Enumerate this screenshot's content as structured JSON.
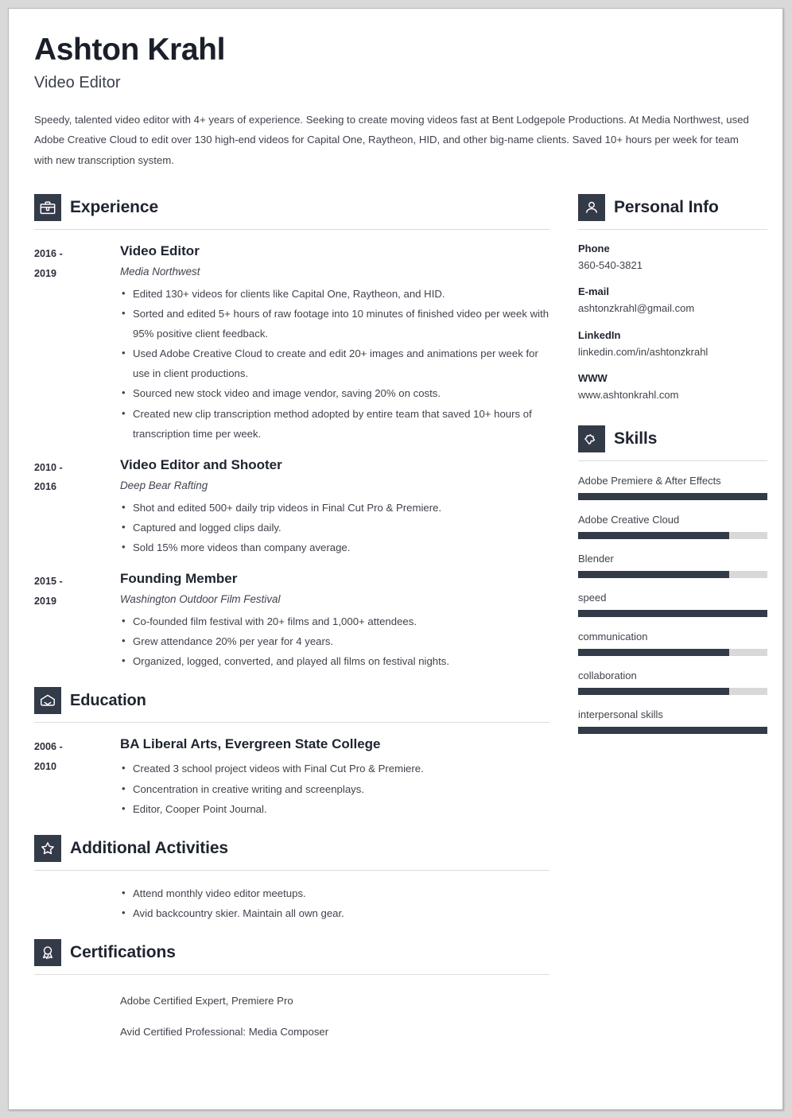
{
  "header": {
    "name": "Ashton Krahl",
    "job_title": "Video Editor",
    "summary": "Speedy, talented video editor with 4+ years of experience. Seeking to create moving videos fast at Bent Lodgepole Productions. At Media Northwest, used Adobe Creative Cloud to edit over 130 high-end videos for Capital One, Raytheon, HID, and other big-name clients. Saved 10+ hours per week for team with new transcription system."
  },
  "colors": {
    "accent_dark": "#333a48",
    "text": "#40434c",
    "heading": "#1f2430",
    "track": "#d8d8d6",
    "rule": "#dcdcdc"
  },
  "sections": {
    "experience": {
      "title": "Experience",
      "icon": "briefcase-icon",
      "entries": [
        {
          "dates": "2016 - 2019",
          "date_line1": "2016 -",
          "date_line2": "2019",
          "title": "Video Editor",
          "org": "Media Northwest",
          "bullets": [
            "Edited 130+ videos for clients like Capital One, Raytheon, and HID.",
            "Sorted and edited 5+ hours of raw footage into 10 minutes of finished video per week with 95% positive client feedback.",
            "Used Adobe Creative Cloud to create and edit 20+ images and animations per week for use in client productions.",
            "Sourced new stock video and image vendor, saving 20% on costs.",
            "Created new clip transcription method adopted by entire team that saved 10+ hours of transcription time per week."
          ]
        },
        {
          "dates": "2010 - 2016",
          "date_line1": "2010 -",
          "date_line2": "2016",
          "title": "Video Editor and Shooter",
          "org": "Deep Bear Rafting",
          "bullets": [
            "Shot and edited 500+ daily trip videos in Final Cut Pro & Premiere.",
            "Captured and logged clips daily.",
            "Sold 15% more videos than company average."
          ]
        },
        {
          "dates": "2015 - 2019",
          "date_line1": "2015 -",
          "date_line2": "2019",
          "title": "Founding Member",
          "org": "Washington Outdoor Film Festival",
          "bullets": [
            "Co-founded film festival with 20+ films and 1,000+ attendees.",
            "Grew attendance 20% per year for 4 years.",
            "Organized, logged, converted, and played all films on festival nights."
          ]
        }
      ]
    },
    "education": {
      "title": "Education",
      "icon": "graduation-cap-icon",
      "entries": [
        {
          "dates": "2006 - 2010",
          "date_line1": "2006 -",
          "date_line2": "2010",
          "title": "BA Liberal Arts, Evergreen State College",
          "bullets": [
            "Created 3 school project videos with Final Cut Pro & Premiere.",
            "Concentration in creative writing and screenplays.",
            "Editor, Cooper Point Journal."
          ]
        }
      ]
    },
    "additional_activities": {
      "title": "Additional Activities",
      "icon": "star-icon",
      "bullets": [
        "Attend monthly video editor meetups.",
        "Avid backcountry skier. Maintain all own gear."
      ]
    },
    "certifications": {
      "title": "Certifications",
      "icon": "award-ribbon-icon",
      "items": [
        "Adobe Certified Expert, Premiere Pro",
        "Avid Certified Professional: Media Composer"
      ]
    },
    "personal_info": {
      "title": "Personal Info",
      "icon": "person-icon",
      "fields": [
        {
          "label": "Phone",
          "value": "360-540-3821"
        },
        {
          "label": "E-mail",
          "value": "ashtonzkrahl@gmail.com"
        },
        {
          "label": "LinkedIn",
          "value": "linkedin.com/in/ashtonzkrahl"
        },
        {
          "label": "WWW",
          "value": "www.ashtonkrahl.com"
        }
      ]
    },
    "skills": {
      "title": "Skills",
      "icon": "puzzle-piece-icon",
      "items": [
        {
          "name": "Adobe Premiere & After Effects",
          "level": 100
        },
        {
          "name": "Adobe Creative Cloud",
          "level": 80
        },
        {
          "name": "Blender",
          "level": 80
        },
        {
          "name": "speed",
          "level": 100
        },
        {
          "name": "communication",
          "level": 80
        },
        {
          "name": "collaboration",
          "level": 80
        },
        {
          "name": "interpersonal skills",
          "level": 100
        }
      ]
    }
  }
}
